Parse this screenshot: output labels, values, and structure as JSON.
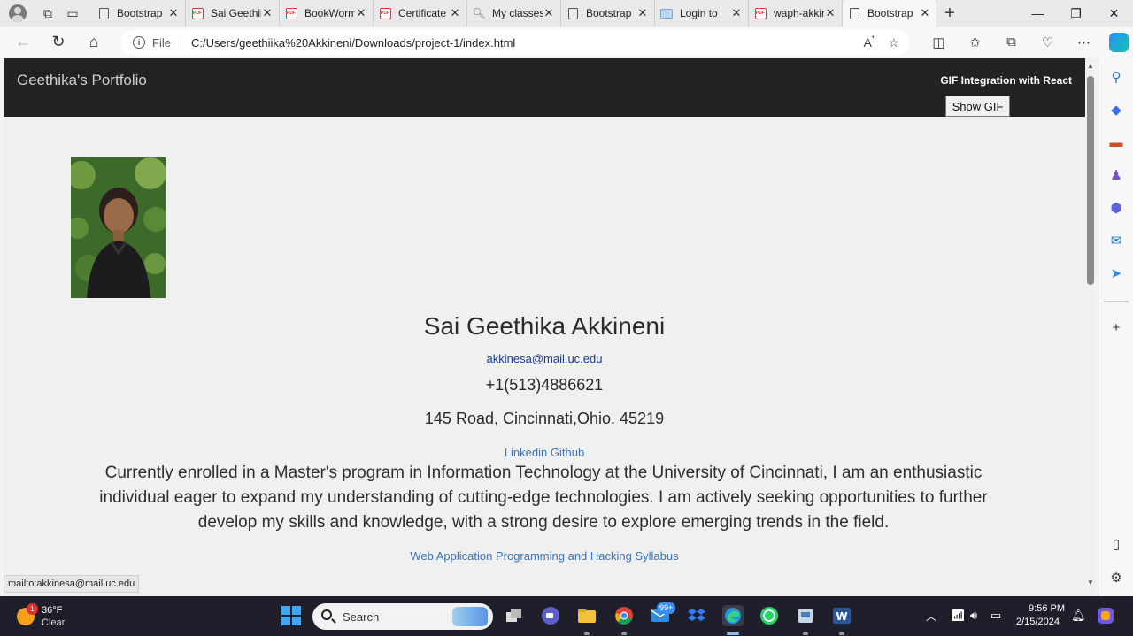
{
  "browser": {
    "tabs": [
      {
        "title": "Bootstrap",
        "favicon": "document-icon",
        "active": false
      },
      {
        "title": "Sai Geethika",
        "favicon": "pdf-icon",
        "active": false
      },
      {
        "title": "BookWorm",
        "favicon": "pdf-icon",
        "active": false
      },
      {
        "title": "Certificate",
        "favicon": "pdf-icon",
        "active": false
      },
      {
        "title": "My classes",
        "favicon": "search-icon",
        "active": false
      },
      {
        "title": "Bootstrap",
        "favicon": "document-icon",
        "active": false
      },
      {
        "title": "Login to",
        "favicon": "image-icon",
        "active": false
      },
      {
        "title": "waph-akkinesa",
        "favicon": "pdf-icon",
        "active": false
      },
      {
        "title": "Bootstrap",
        "favicon": "document-icon",
        "active": true
      }
    ],
    "address": {
      "scheme_label": "File",
      "url": "C:/Users/geethiika%20Akkineni/Downloads/project-1/index.html"
    },
    "status_url": "mailto:akkinesa@mail.uc.edu"
  },
  "page": {
    "brand": "Geethika's Portfolio",
    "gif_title": "GIF Integration with React",
    "gif_button": "Show GIF",
    "name": "Sai Geethika Akkineni",
    "email": "akkinesa@mail.uc.edu",
    "phone": "+1(513)4886621",
    "address": "145 Road, Cincinnati,Ohio. 45219",
    "links": {
      "linkedin": "Linkedin",
      "github": "Github"
    },
    "bio": "Currently enrolled in a Master's program in Information Technology at the University of Cincinnati, I am an enthusiastic individual eager to expand my understanding of cutting-edge technologies. I am actively seeking opportunities to further develop my skills and knowledge, with a strong desire to explore emerging trends in the field.",
    "syllabus_link": "Web Application Programming and Hacking Syllabus"
  },
  "taskbar": {
    "weather": {
      "temp": "36°F",
      "condition": "Clear",
      "badge": "1"
    },
    "search_placeholder": "Search",
    "mail_badge": "99+",
    "clock": {
      "time": "9:56 PM",
      "date": "2/15/2024"
    }
  },
  "colors": {
    "navbar": "#222222",
    "link": "#3a74b8",
    "taskbar": "#1f1e2b"
  }
}
